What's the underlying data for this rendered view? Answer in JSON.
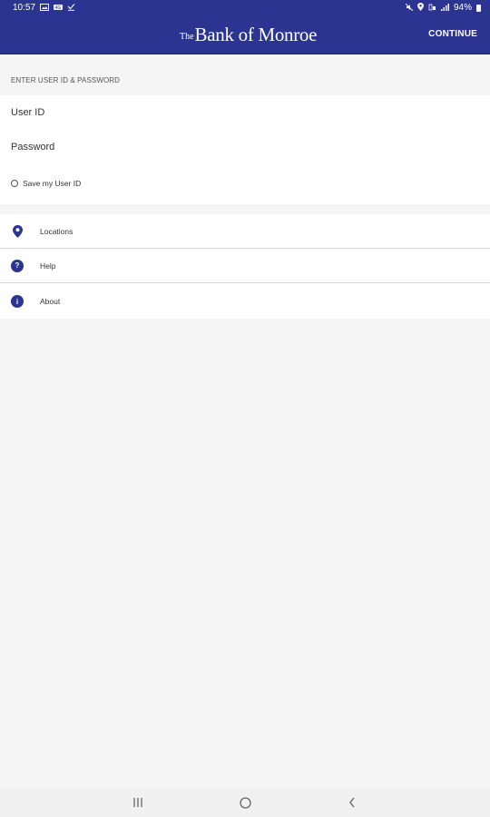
{
  "status_bar": {
    "time": "10:57",
    "battery_text": "94%",
    "left_icons": [
      "gallery-icon",
      "sim-icon",
      "download-icon"
    ],
    "right_icons": [
      "mute-icon",
      "location-icon",
      "wifi-icon",
      "signal-icon",
      "battery-icon"
    ]
  },
  "app_bar": {
    "logo_the": "The",
    "logo_main": "Bank of Monroe",
    "continue_label": "CONTINUE",
    "background_color": "#2b3591"
  },
  "login": {
    "section_header": "ENTER USER ID & PASSWORD",
    "user_id_placeholder": "User ID",
    "user_id_value": "",
    "password_placeholder": "Password",
    "password_value": "",
    "save_user_id_label": "Save my User ID",
    "save_user_id_checked": false
  },
  "menu": {
    "items": [
      {
        "label": "Locations",
        "icon": "location-pin-icon"
      },
      {
        "label": "Help",
        "icon": "help-icon",
        "glyph": "?"
      },
      {
        "label": "About",
        "icon": "info-icon",
        "glyph": "i"
      }
    ]
  },
  "nav_bar": {
    "buttons": [
      "recent-apps-icon",
      "home-icon",
      "back-icon"
    ]
  }
}
